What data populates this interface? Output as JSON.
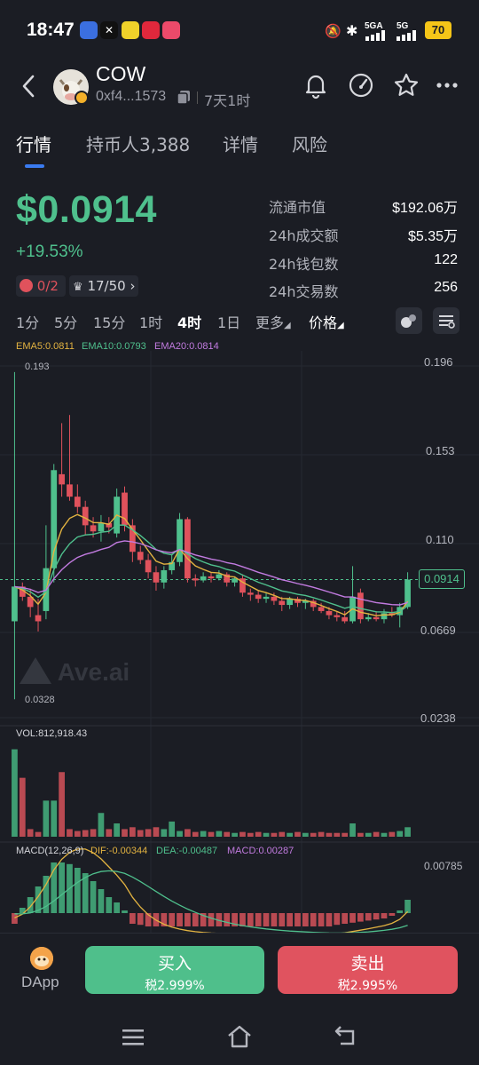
{
  "status_bar": {
    "time": "18:47",
    "network_1": "5GA",
    "network_2": "5G",
    "battery": "70"
  },
  "header": {
    "title": "COW",
    "address": "0xf4...1573",
    "age": "7天1时"
  },
  "tabs": [
    {
      "label": "行情",
      "active": true
    },
    {
      "label": "持币人3,388",
      "active": false
    },
    {
      "label": "详情",
      "active": false
    },
    {
      "label": "风险",
      "active": false
    }
  ],
  "price": {
    "value": "$0.0914",
    "change": "+19.53%",
    "chip1": "0/2",
    "chip2": "17/50"
  },
  "stats": [
    {
      "label": "流通市值",
      "value": "$192.06万"
    },
    {
      "label": "24h成交额",
      "value": "$5.35万"
    },
    {
      "label": "24h钱包数",
      "value": "122"
    },
    {
      "label": "24h交易数",
      "value": "256"
    }
  ],
  "intervals": [
    {
      "label": "1分",
      "active": false
    },
    {
      "label": "5分",
      "active": false
    },
    {
      "label": "15分",
      "active": false
    },
    {
      "label": "1时",
      "active": false
    },
    {
      "label": "4时",
      "active": true
    },
    {
      "label": "1日",
      "active": false
    },
    {
      "label": "更多",
      "active": false
    },
    {
      "label": "价格",
      "active": false
    }
  ],
  "chart": {
    "ema5": "EMA5:0.0811",
    "ema10": "EMA10:0.0793",
    "ema20": "EMA20:0.0814",
    "y_labels": [
      "0.196",
      "0.153",
      "0.110",
      "0.0669",
      "0.0238"
    ],
    "current_price_tag": "0.0914",
    "high_marker": "0.193",
    "low_marker": "0.0328",
    "watermark": "Ave.ai",
    "vol_label": "VOL:812,918.43",
    "macd_label": "MACD(12,26,9)",
    "dif_label": "DIF:-0.00344",
    "dea_label": "DEA:-0.00487",
    "macd_value_label": "MACD:0.00287",
    "macd_y_label": "0.00785",
    "colors": {
      "up": "#4fc08d",
      "down": "#e0525c",
      "ema5": "#e3b341",
      "ema10": "#4fc08d",
      "ema20": "#c27be0"
    }
  },
  "chart_data": {
    "type": "candlestick",
    "ylim": [
      0.0238,
      0.196
    ],
    "candles": [
      {
        "o": 0.071,
        "h": 0.193,
        "l": 0.0328,
        "c": 0.088
      },
      {
        "o": 0.088,
        "h": 0.09,
        "l": 0.081,
        "c": 0.083
      },
      {
        "o": 0.083,
        "h": 0.087,
        "l": 0.073,
        "c": 0.078
      },
      {
        "o": 0.074,
        "h": 0.082,
        "l": 0.066,
        "c": 0.071
      },
      {
        "o": 0.076,
        "h": 0.118,
        "l": 0.072,
        "c": 0.097
      },
      {
        "o": 0.097,
        "h": 0.148,
        "l": 0.09,
        "c": 0.145
      },
      {
        "o": 0.143,
        "h": 0.168,
        "l": 0.132,
        "c": 0.138
      },
      {
        "o": 0.138,
        "h": 0.172,
        "l": 0.13,
        "c": 0.132
      },
      {
        "o": 0.132,
        "h": 0.138,
        "l": 0.124,
        "c": 0.127
      },
      {
        "o": 0.127,
        "h": 0.13,
        "l": 0.113,
        "c": 0.118
      },
      {
        "o": 0.118,
        "h": 0.122,
        "l": 0.112,
        "c": 0.115
      },
      {
        "o": 0.115,
        "h": 0.123,
        "l": 0.11,
        "c": 0.119
      },
      {
        "o": 0.119,
        "h": 0.122,
        "l": 0.114,
        "c": 0.117
      },
      {
        "o": 0.114,
        "h": 0.136,
        "l": 0.112,
        "c": 0.132
      },
      {
        "o": 0.134,
        "h": 0.137,
        "l": 0.115,
        "c": 0.118
      },
      {
        "o": 0.118,
        "h": 0.121,
        "l": 0.1,
        "c": 0.105
      },
      {
        "o": 0.105,
        "h": 0.108,
        "l": 0.099,
        "c": 0.101
      },
      {
        "o": 0.101,
        "h": 0.104,
        "l": 0.092,
        "c": 0.095
      },
      {
        "o": 0.095,
        "h": 0.098,
        "l": 0.086,
        "c": 0.09
      },
      {
        "o": 0.09,
        "h": 0.098,
        "l": 0.087,
        "c": 0.096
      },
      {
        "o": 0.096,
        "h": 0.104,
        "l": 0.094,
        "c": 0.1
      },
      {
        "o": 0.1,
        "h": 0.124,
        "l": 0.098,
        "c": 0.121
      },
      {
        "o": 0.121,
        "h": 0.122,
        "l": 0.09,
        "c": 0.092
      },
      {
        "o": 0.092,
        "h": 0.094,
        "l": 0.088,
        "c": 0.091
      },
      {
        "o": 0.091,
        "h": 0.095,
        "l": 0.09,
        "c": 0.093
      },
      {
        "o": 0.093,
        "h": 0.095,
        "l": 0.09,
        "c": 0.092
      },
      {
        "o": 0.092,
        "h": 0.096,
        "l": 0.091,
        "c": 0.094
      },
      {
        "o": 0.094,
        "h": 0.095,
        "l": 0.088,
        "c": 0.09
      },
      {
        "o": 0.09,
        "h": 0.093,
        "l": 0.088,
        "c": 0.092
      },
      {
        "o": 0.092,
        "h": 0.094,
        "l": 0.083,
        "c": 0.085
      },
      {
        "o": 0.085,
        "h": 0.087,
        "l": 0.081,
        "c": 0.084
      },
      {
        "o": 0.084,
        "h": 0.086,
        "l": 0.08,
        "c": 0.082
      },
      {
        "o": 0.082,
        "h": 0.085,
        "l": 0.08,
        "c": 0.083
      },
      {
        "o": 0.083,
        "h": 0.085,
        "l": 0.079,
        "c": 0.081
      },
      {
        "o": 0.081,
        "h": 0.083,
        "l": 0.076,
        "c": 0.079
      },
      {
        "o": 0.079,
        "h": 0.083,
        "l": 0.077,
        "c": 0.082
      },
      {
        "o": 0.082,
        "h": 0.083,
        "l": 0.078,
        "c": 0.08
      },
      {
        "o": 0.08,
        "h": 0.082,
        "l": 0.077,
        "c": 0.081
      },
      {
        "o": 0.081,
        "h": 0.082,
        "l": 0.076,
        "c": 0.078
      },
      {
        "o": 0.078,
        "h": 0.08,
        "l": 0.075,
        "c": 0.076
      },
      {
        "o": 0.076,
        "h": 0.078,
        "l": 0.072,
        "c": 0.074
      },
      {
        "o": 0.074,
        "h": 0.076,
        "l": 0.071,
        "c": 0.073
      },
      {
        "o": 0.073,
        "h": 0.076,
        "l": 0.07,
        "c": 0.071
      },
      {
        "o": 0.071,
        "h": 0.098,
        "l": 0.07,
        "c": 0.083
      },
      {
        "o": 0.085,
        "h": 0.087,
        "l": 0.07,
        "c": 0.072
      },
      {
        "o": 0.072,
        "h": 0.075,
        "l": 0.071,
        "c": 0.073
      },
      {
        "o": 0.073,
        "h": 0.076,
        "l": 0.071,
        "c": 0.072
      },
      {
        "o": 0.072,
        "h": 0.077,
        "l": 0.07,
        "c": 0.075
      },
      {
        "o": 0.075,
        "h": 0.078,
        "l": 0.073,
        "c": 0.074
      },
      {
        "o": 0.074,
        "h": 0.08,
        "l": 0.068,
        "c": 0.078
      },
      {
        "o": 0.078,
        "h": 0.095,
        "l": 0.077,
        "c": 0.0914
      }
    ],
    "volume": [
      0.92,
      0.62,
      0.08,
      0.05,
      0.38,
      0.38,
      0.68,
      0.08,
      0.06,
      0.07,
      0.08,
      0.25,
      0.08,
      0.14,
      0.08,
      0.1,
      0.07,
      0.08,
      0.1,
      0.08,
      0.16,
      0.06,
      0.08,
      0.05,
      0.06,
      0.05,
      0.06,
      0.05,
      0.04,
      0.05,
      0.04,
      0.05,
      0.04,
      0.04,
      0.05,
      0.04,
      0.05,
      0.04,
      0.04,
      0.05,
      0.04,
      0.04,
      0.04,
      0.14,
      0.04,
      0.04,
      0.05,
      0.04,
      0.05,
      0.06,
      0.1
    ],
    "macd_hist": [
      -0.2,
      0.1,
      0.3,
      0.5,
      0.7,
      0.95,
      0.95,
      0.92,
      0.85,
      0.75,
      0.6,
      0.45,
      0.3,
      0.2,
      0.05,
      -0.2,
      -0.22,
      -0.25,
      -0.25,
      -0.25,
      -0.25,
      -0.25,
      -0.25,
      -0.25,
      -0.25,
      -0.25,
      -0.25,
      -0.25,
      -0.25,
      -0.25,
      -0.25,
      -0.25,
      -0.25,
      -0.25,
      -0.25,
      -0.25,
      -0.25,
      -0.25,
      -0.25,
      -0.25,
      -0.25,
      -0.22,
      -0.2,
      -0.18,
      -0.16,
      -0.14,
      -0.12,
      -0.1,
      -0.05,
      0.05,
      0.25
    ]
  },
  "actions": {
    "dapp": "DApp",
    "buy_label": "买入",
    "buy_tax": "税2.999%",
    "sell_label": "卖出",
    "sell_tax": "税2.995%"
  }
}
